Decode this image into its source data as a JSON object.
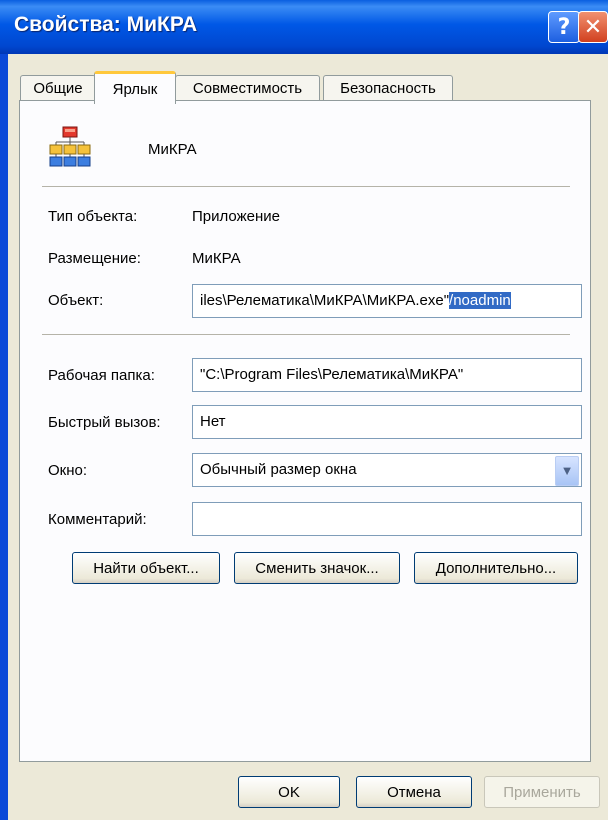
{
  "window": {
    "title": "Свойства: МиКРА",
    "help_glyph": "?",
    "close_glyph": "✕"
  },
  "tabs": [
    "Общие",
    "Ярлык",
    "Совместимость",
    "Безопасность"
  ],
  "app": {
    "name": "МиКРА"
  },
  "fields": {
    "type_label": "Тип объекта:",
    "type_value": "Приложение",
    "location_label": "Размещение:",
    "location_value": "МиКРА",
    "target_label": "Объект:",
    "target_value_plain": "iles\\Релематика\\МиКРА\\МиКРА.exe\"",
    "target_value_selected": "/noadmin",
    "workdir_label": "Рабочая папка:",
    "workdir_value": "\"C:\\Program Files\\Релематика\\МиКРА\"",
    "hotkey_label": "Быстрый вызов:",
    "hotkey_value": "Нет",
    "window_label": "Окно:",
    "window_value": "Обычный размер окна",
    "comment_label": "Комментарий:",
    "comment_value": ""
  },
  "buttons": {
    "find_target": "Найти объект...",
    "change_icon": "Сменить значок...",
    "advanced": "Дополнительно...",
    "ok": "OK",
    "cancel": "Отмена",
    "apply": "Применить"
  },
  "icons": {
    "app": "org-chart-icon",
    "dropdown": "chevron-down-icon",
    "help": "help-icon",
    "close": "close-icon"
  }
}
